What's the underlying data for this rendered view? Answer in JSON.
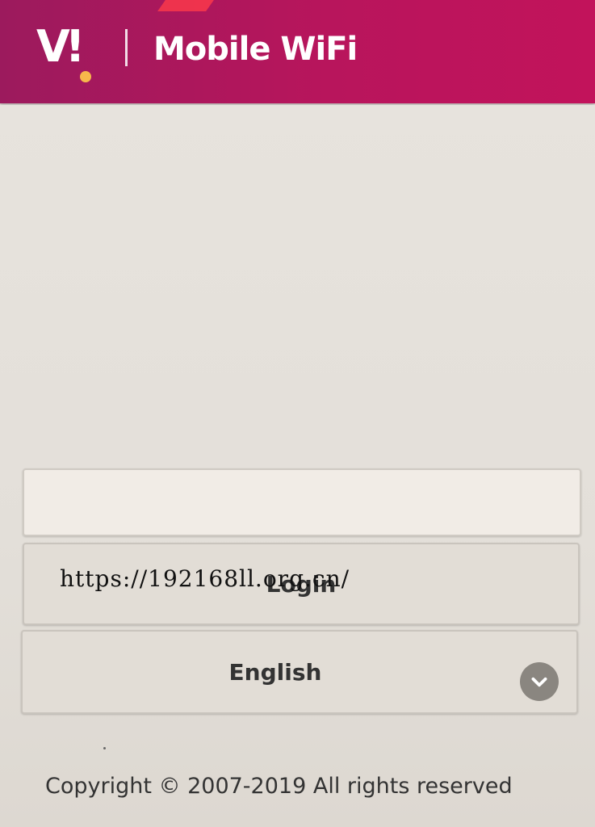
{
  "header": {
    "logo_text": "V!",
    "app_title": "Mobile WiFi"
  },
  "login_form": {
    "password_value": "",
    "password_placeholder": "",
    "login_label": "Login",
    "language_selected": "English"
  },
  "watermark": "https://192168ll.org.cn/",
  "footer": {
    "copyright": "Copyright © 2007-2019 All rights reserved"
  },
  "icons": {
    "language_dropdown": "chevron-down-icon"
  },
  "colors": {
    "brand": "#b8155c",
    "logo_dot": "#f7b84b"
  }
}
